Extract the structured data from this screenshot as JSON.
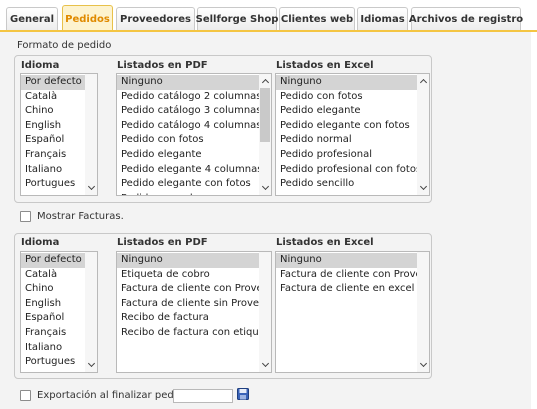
{
  "tabs": [
    {
      "label": "General"
    },
    {
      "label": "Pedidos"
    },
    {
      "label": "Proveedores"
    },
    {
      "label": "Sellforge Shop"
    },
    {
      "label": "Clientes web"
    },
    {
      "label": "Idiomas"
    },
    {
      "label": "Archivos de registro"
    }
  ],
  "active_tab": "Pedidos",
  "colors": {
    "accent": "#f4c542",
    "active_tab_text": "#e08a00",
    "panel_bg": "#f3f3f3"
  },
  "section_title": "Formato de pedido",
  "orders": {
    "col_language": "Idioma",
    "col_pdf": "Listados en PDF",
    "col_excel": "Listados en Excel",
    "languages": [
      "Por defecto",
      "Català",
      "Chino",
      "English",
      "Español",
      "Français",
      "Italiano",
      "Portugues"
    ],
    "pdf_lists": [
      "Ninguno",
      "Pedido catálogo 2 columnas",
      "Pedido catálogo 3 columnas",
      "Pedido catálogo 4 columnas",
      "Pedido con fotos",
      "Pedido elegante",
      "Pedido elegante 4 columnas",
      "Pedido elegante con fotos",
      "Pedido normal"
    ],
    "excel_lists": [
      "Ninguno",
      "Pedido con fotos",
      "Pedido elegante",
      "Pedido elegante con fotos",
      "Pedido normal",
      "Pedido profesional",
      "Pedido profesional con fotos",
      "Pedido sencillo"
    ]
  },
  "show_invoices_label": "Mostrar Facturas.",
  "invoices": {
    "col_language": "Idioma",
    "col_pdf": "Listados en PDF",
    "col_excel": "Listados en Excel",
    "languages": [
      "Por defecto",
      "Català",
      "Chino",
      "English",
      "Español",
      "Français",
      "Italiano",
      "Portugues"
    ],
    "pdf_lists": [
      "Ninguno",
      "Etiqueta de cobro",
      "Factura de cliente con Proveedor",
      "Factura de cliente sin Proveedor",
      "Recibo de factura",
      "Recibo de factura con etiqueta"
    ],
    "excel_lists": [
      "Ninguno",
      "Factura de cliente con Proveedor",
      "Factura de cliente en excel"
    ]
  },
  "export_label": "Exportación al finalizar pedido:",
  "export_value": "",
  "icons": {
    "save": "save-disk-icon",
    "scroll_up": "chevron-up-icon",
    "scroll_down": "chevron-down-icon"
  }
}
